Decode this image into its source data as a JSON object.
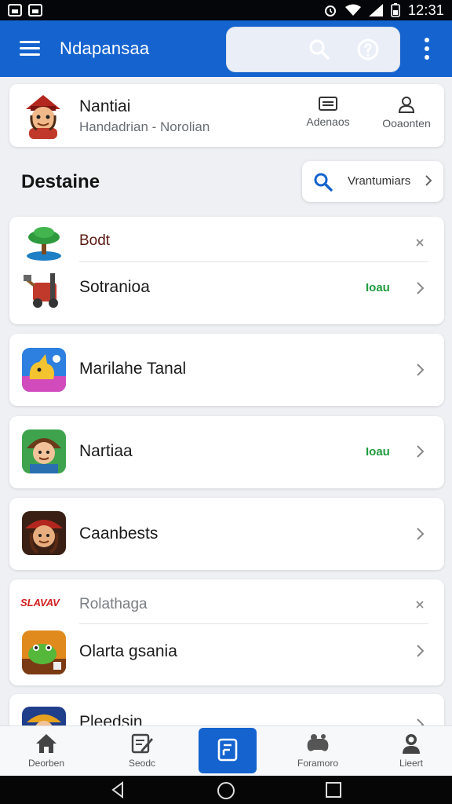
{
  "status_bar": {
    "time": "12:31"
  },
  "app_bar": {
    "title": "Ndapansaa",
    "icons": {
      "menu": "hamburger-menu-icon",
      "search": "search-icon",
      "help": "help-circle-icon",
      "more": "more-vert-icon"
    }
  },
  "profile": {
    "name": "Nantiai",
    "subtitle": "Handadrian - Norolian",
    "actions": [
      {
        "label": "Adenaos",
        "icon": "card-icon"
      },
      {
        "label": "Ooaonten",
        "icon": "person-icon"
      }
    ]
  },
  "section": {
    "title": "Destaine",
    "filter": {
      "label": "Vrantumiars",
      "icon": "search-icon"
    }
  },
  "cards": [
    {
      "rows": [
        {
          "label": "Bodt",
          "icon": "tree-island-icon",
          "tag": ""
        },
        {
          "label": "Sotranioa",
          "icon": "tools-game-icon",
          "tag": "Ioau"
        }
      ]
    },
    {
      "rows": [
        {
          "label": "Marilahe Tanal",
          "icon": "pikachu-game-icon",
          "tag": ""
        }
      ]
    },
    {
      "rows": [
        {
          "label": "Nartiaa",
          "icon": "adventurer-game-icon",
          "tag": "Ioau"
        }
      ]
    },
    {
      "rows": [
        {
          "label": "Caanbests",
          "icon": "pirate-game-icon",
          "tag": ""
        }
      ]
    },
    {
      "rows": [
        {
          "label": "Rolathaga",
          "icon": "brand-logo",
          "logo_text": "SLAVAV",
          "tag": ""
        },
        {
          "label": "Olarta gsania",
          "icon": "frog-game-icon",
          "tag": ""
        }
      ]
    },
    {
      "rows": [
        {
          "label": "Pleedsin",
          "icon": "gold-game-icon",
          "tag": ""
        }
      ]
    }
  ],
  "bottom_nav": [
    {
      "label": "Deorben",
      "icon": "home-icon"
    },
    {
      "label": "Seodc",
      "icon": "edit-icon"
    },
    {
      "label": "",
      "icon": "document-icon"
    },
    {
      "label": "Foramoro",
      "icon": "gamepad-icon"
    },
    {
      "label": "Lieert",
      "icon": "person-icon"
    }
  ],
  "colors": {
    "primary": "#1463cf",
    "accent_green": "#1f9a3d",
    "background": "#eef0f4",
    "status_bar": "#05060a"
  }
}
